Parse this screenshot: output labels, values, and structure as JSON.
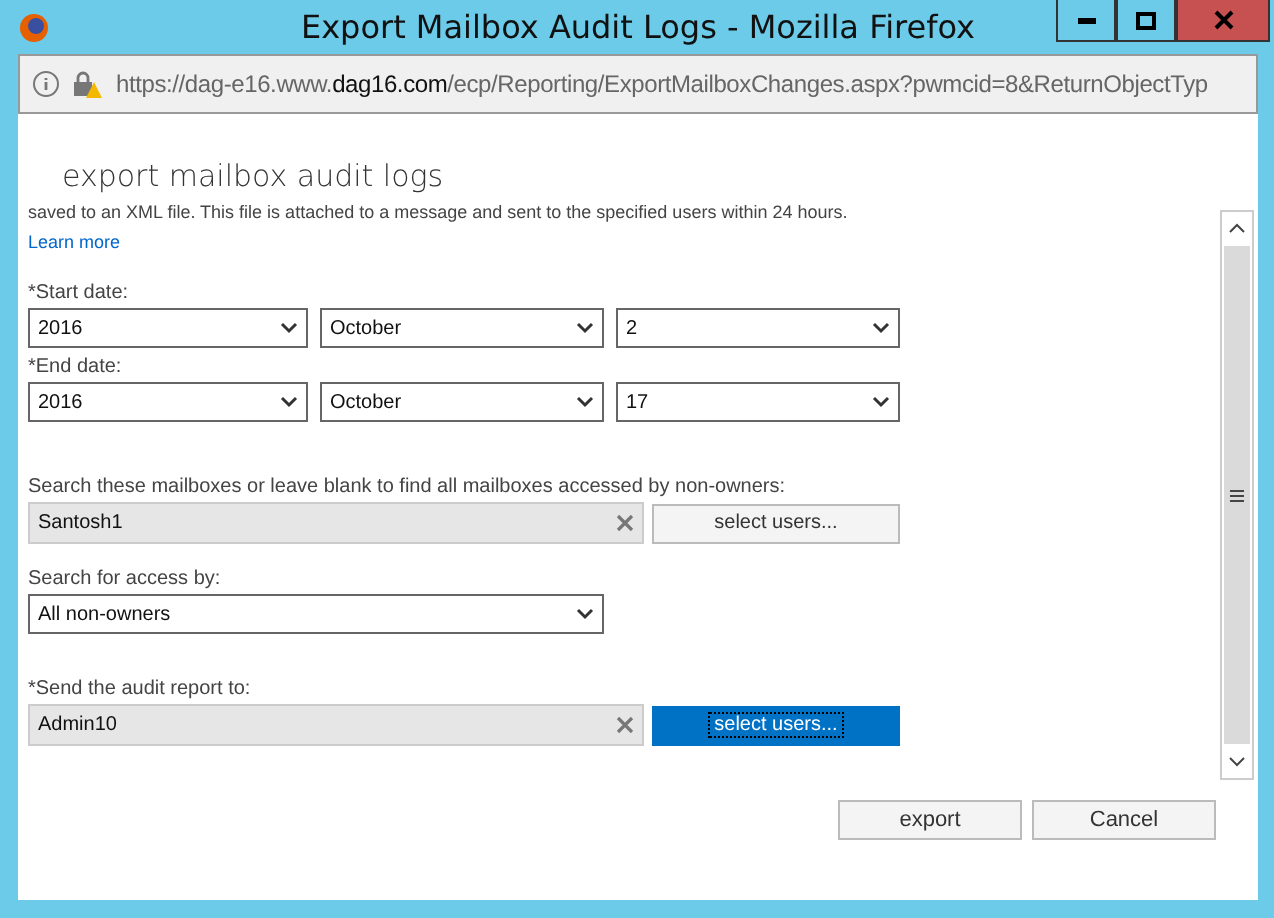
{
  "window": {
    "title": "Export Mailbox Audit Logs - Mozilla Firefox"
  },
  "address_bar": {
    "url": "https://dag-e16.www.**dag16.com**/ecp/Reporting/ExportMailboxChanges.aspx?pwmcid=8&ReturnObjectTyp"
  },
  "page_title": "export mailbox audit logs",
  "intro": "saved to an XML file. This file is attached to a message and sent to the specified users within 24 hours.",
  "learn_more": "Learn more",
  "dates": [
    {
      "label": "*Start date:",
      "year": "2016",
      "month": "October",
      "day": "2"
    },
    {
      "label": "*End date:",
      "year": "2016",
      "month": "October",
      "day": "17"
    }
  ],
  "pickers": [
    {
      "label": "Search these mailboxes or leave blank to find all mailboxes accessed by non-owners:",
      "value": "Santosh1",
      "button": "select users...",
      "focused": false,
      "after": {
        "label": "Search for access by:",
        "value": "All non-owners"
      }
    },
    {
      "label": "*Send the audit report to:",
      "value": "Admin10",
      "button": "select users...",
      "focused": true
    }
  ],
  "buttons": [
    "export",
    "Cancel"
  ]
}
